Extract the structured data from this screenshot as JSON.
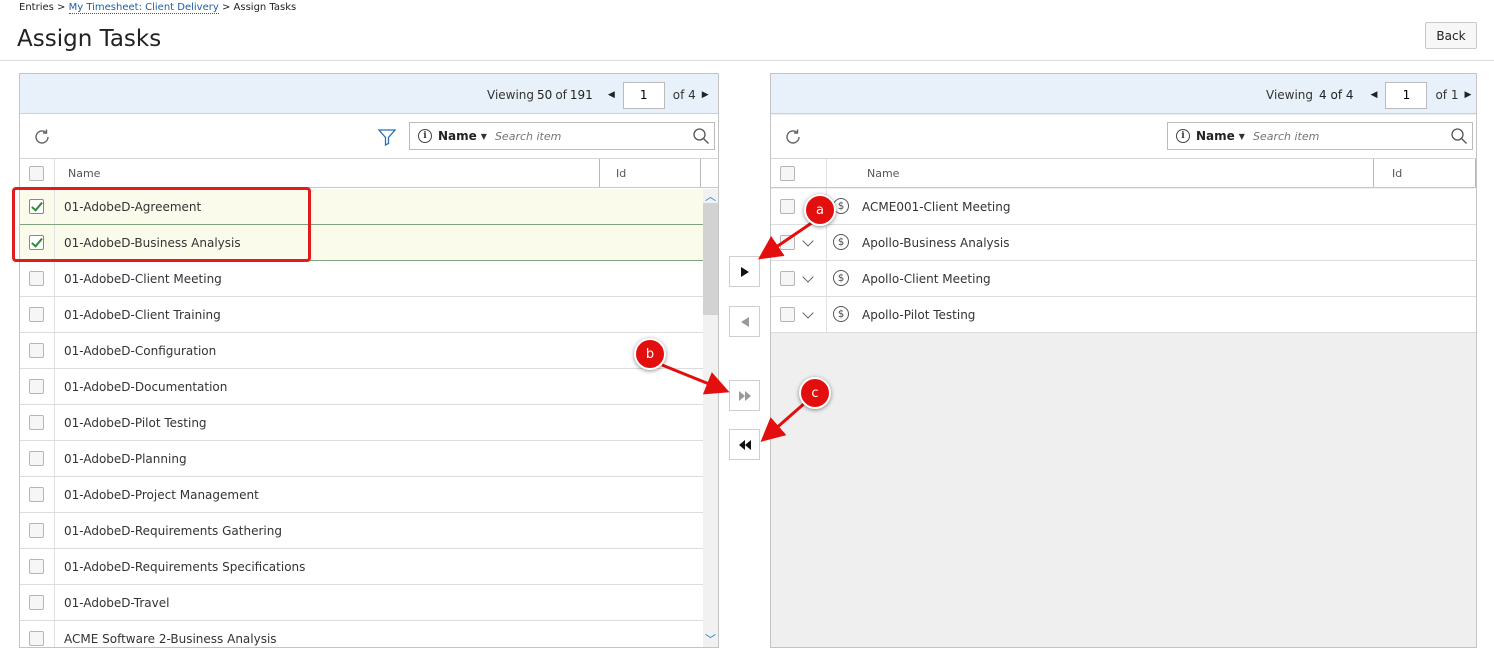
{
  "breadcrumb": {
    "item1": "Entries",
    "sep": ">",
    "link": "My Timesheet: Client Delivery",
    "current": "Assign Tasks"
  },
  "page": {
    "title": "Assign Tasks",
    "back_label": "Back"
  },
  "left": {
    "viewing_label": "Viewing",
    "viewing_count": "50",
    "of_word": "of",
    "total": "191",
    "page": "1",
    "page_of": "of 4",
    "search": {
      "field": "Name",
      "placeholder": "Search item"
    },
    "columns": {
      "name": "Name",
      "id": "Id"
    },
    "rows": [
      {
        "name": "01-AdobeD-Agreement",
        "checked": true
      },
      {
        "name": "01-AdobeD-Business Analysis",
        "checked": true
      },
      {
        "name": "01-AdobeD-Client Meeting",
        "checked": false
      },
      {
        "name": "01-AdobeD-Client Training",
        "checked": false
      },
      {
        "name": "01-AdobeD-Configuration",
        "checked": false
      },
      {
        "name": "01-AdobeD-Documentation",
        "checked": false
      },
      {
        "name": "01-AdobeD-Pilot Testing",
        "checked": false
      },
      {
        "name": "01-AdobeD-Planning",
        "checked": false
      },
      {
        "name": "01-AdobeD-Project Management",
        "checked": false
      },
      {
        "name": "01-AdobeD-Requirements Gathering",
        "checked": false
      },
      {
        "name": "01-AdobeD-Requirements Specifications",
        "checked": false
      },
      {
        "name": "01-AdobeD-Travel",
        "checked": false
      },
      {
        "name": "ACME Software 2-Business Analysis",
        "checked": false
      }
    ]
  },
  "right": {
    "viewing_label": "Viewing",
    "viewing_text": "4 of 4",
    "page": "1",
    "page_of": "of 1",
    "search": {
      "field": "Name",
      "placeholder": "Search item"
    },
    "columns": {
      "name": "Name",
      "id": "Id"
    },
    "rows": [
      {
        "name": "ACME001-Client Meeting",
        "expandable": false
      },
      {
        "name": "Apollo-Business Analysis",
        "expandable": true
      },
      {
        "name": "Apollo-Client Meeting",
        "expandable": true
      },
      {
        "name": "Apollo-Pilot Testing",
        "expandable": true
      }
    ]
  },
  "annotations": {
    "a": "a",
    "b": "b",
    "c": "c"
  },
  "colors": {
    "accent_red": "#e30f0f",
    "header_blue": "#e8f1f9",
    "link": "#1f5fa8"
  }
}
